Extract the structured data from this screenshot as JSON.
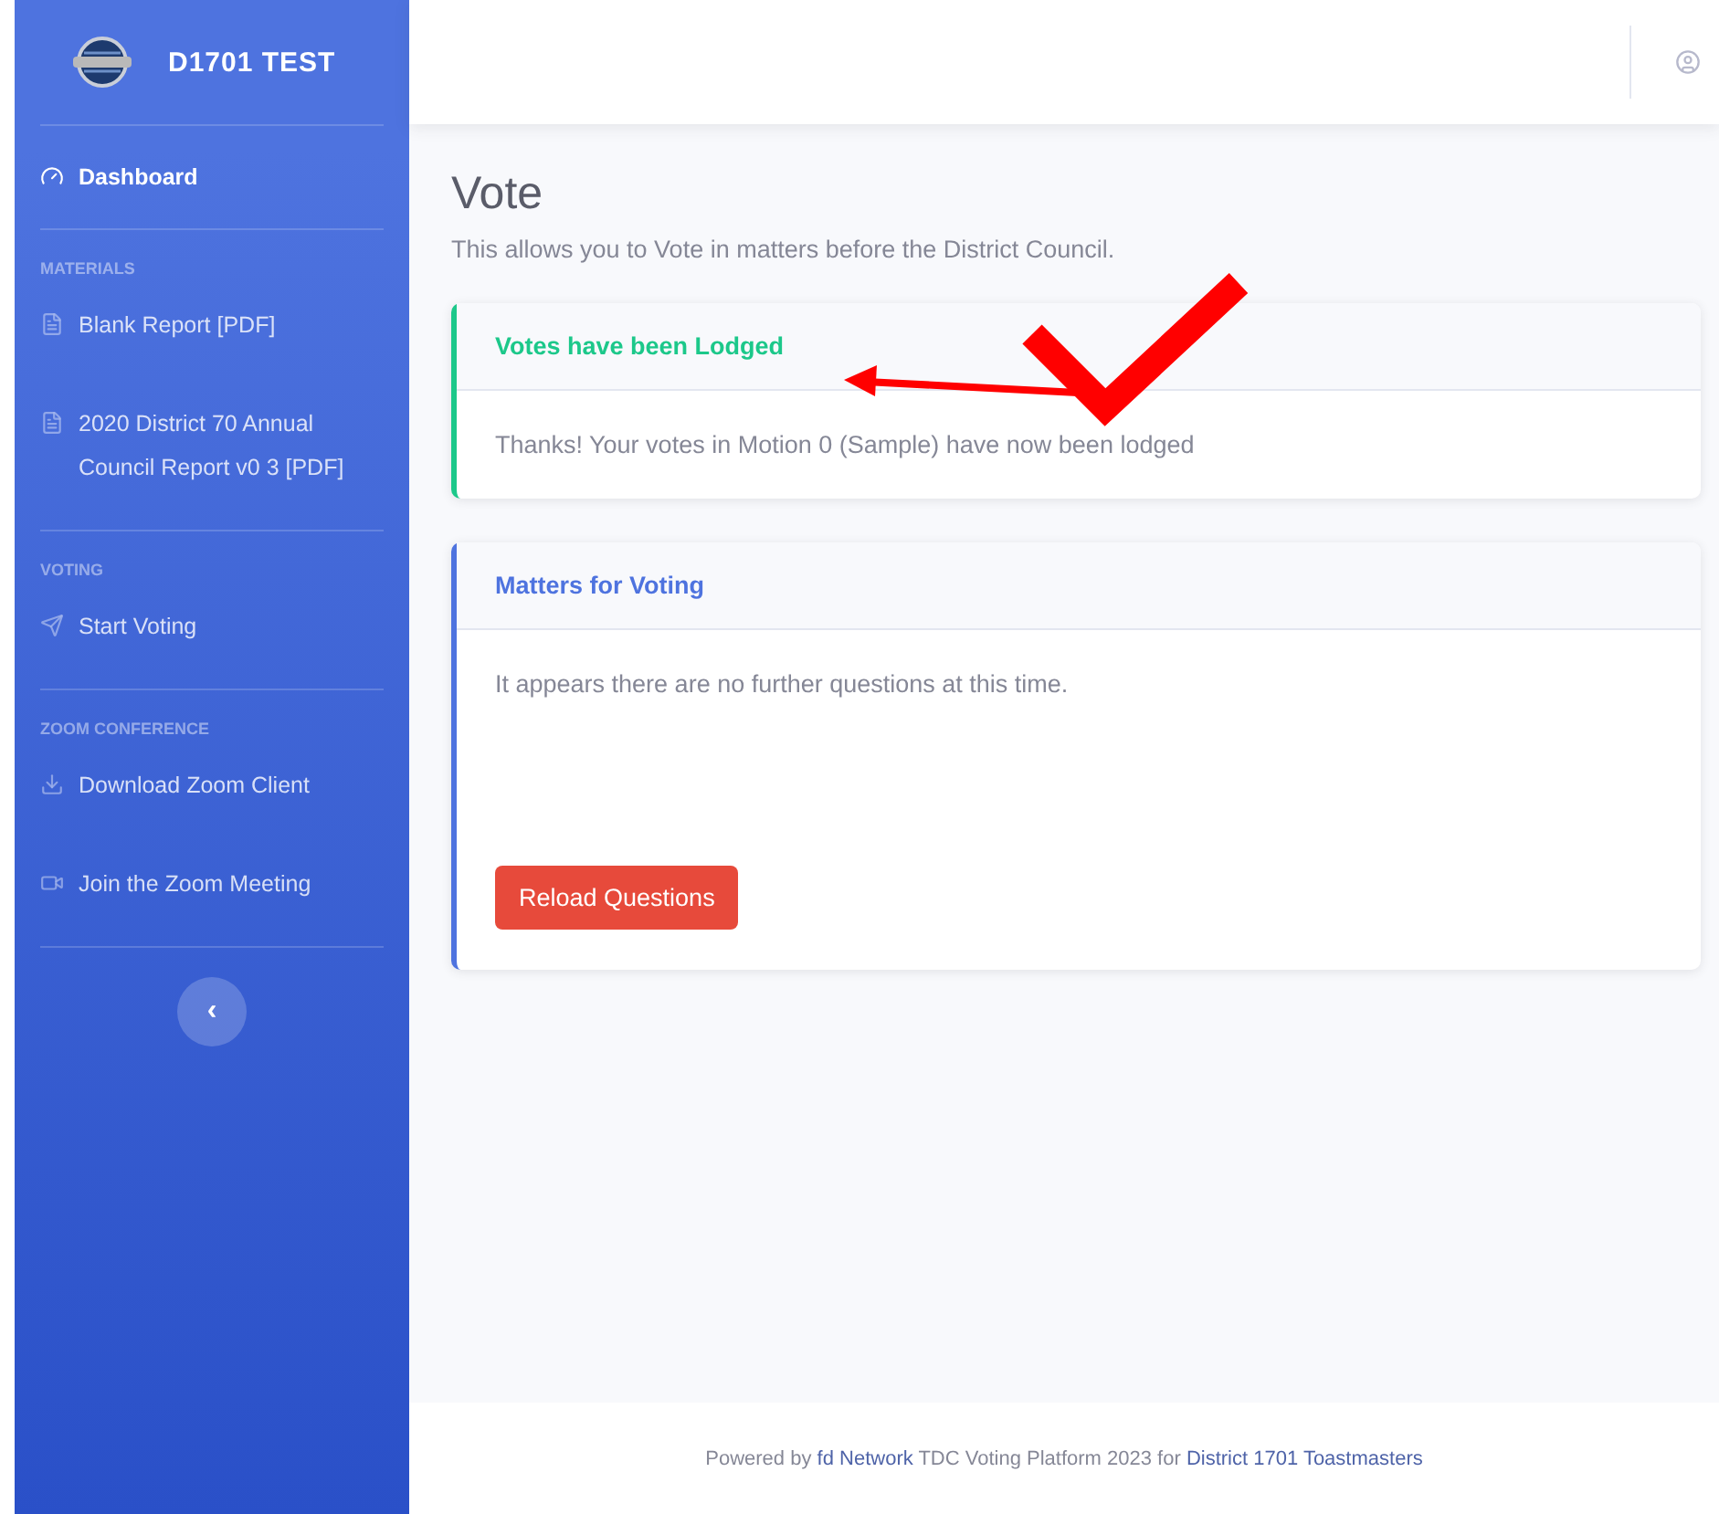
{
  "brand": {
    "title": "D1701 TEST"
  },
  "sidebar": {
    "items": [
      {
        "kind": "link",
        "label": "Dashboard",
        "selected": true
      },
      {
        "kind": "heading",
        "label": "MATERIALS"
      },
      {
        "kind": "link",
        "label": "Blank Report [PDF]",
        "selected": false
      },
      {
        "kind": "link",
        "label": "2020 District 70 Annual Council Report v0 3 [PDF]",
        "selected": false
      },
      {
        "kind": "heading",
        "label": "VOTING"
      },
      {
        "kind": "link",
        "label": "Start Voting",
        "selected": false
      },
      {
        "kind": "heading",
        "label": "ZOOM CONFERENCE"
      },
      {
        "kind": "link",
        "label": "Download Zoom Client",
        "selected": false
      },
      {
        "kind": "link",
        "label": "Join the Zoom Meeting",
        "selected": false
      }
    ],
    "collapse_button": "‹"
  },
  "page": {
    "title": "Vote",
    "subtitle": "This allows you to Vote in matters before the District Council."
  },
  "cards": [
    {
      "title": "Votes have been Lodged",
      "color": "#1cc88a",
      "body": "Thanks! Your votes in Motion 0 (Sample) have now been lodged"
    },
    {
      "title": "Matters for Voting",
      "color": "#4e73df",
      "body": "It appears there are no further questions at this time.",
      "button": "Reload Questions"
    }
  ],
  "footer": {
    "parts": [
      {
        "kind": "text",
        "text": "Powered by "
      },
      {
        "kind": "link",
        "text": "fd Network"
      },
      {
        "kind": "text",
        "text": " TDC Voting Platform 2023 for "
      },
      {
        "kind": "link",
        "text": "District 1701 Toastmasters"
      }
    ]
  }
}
